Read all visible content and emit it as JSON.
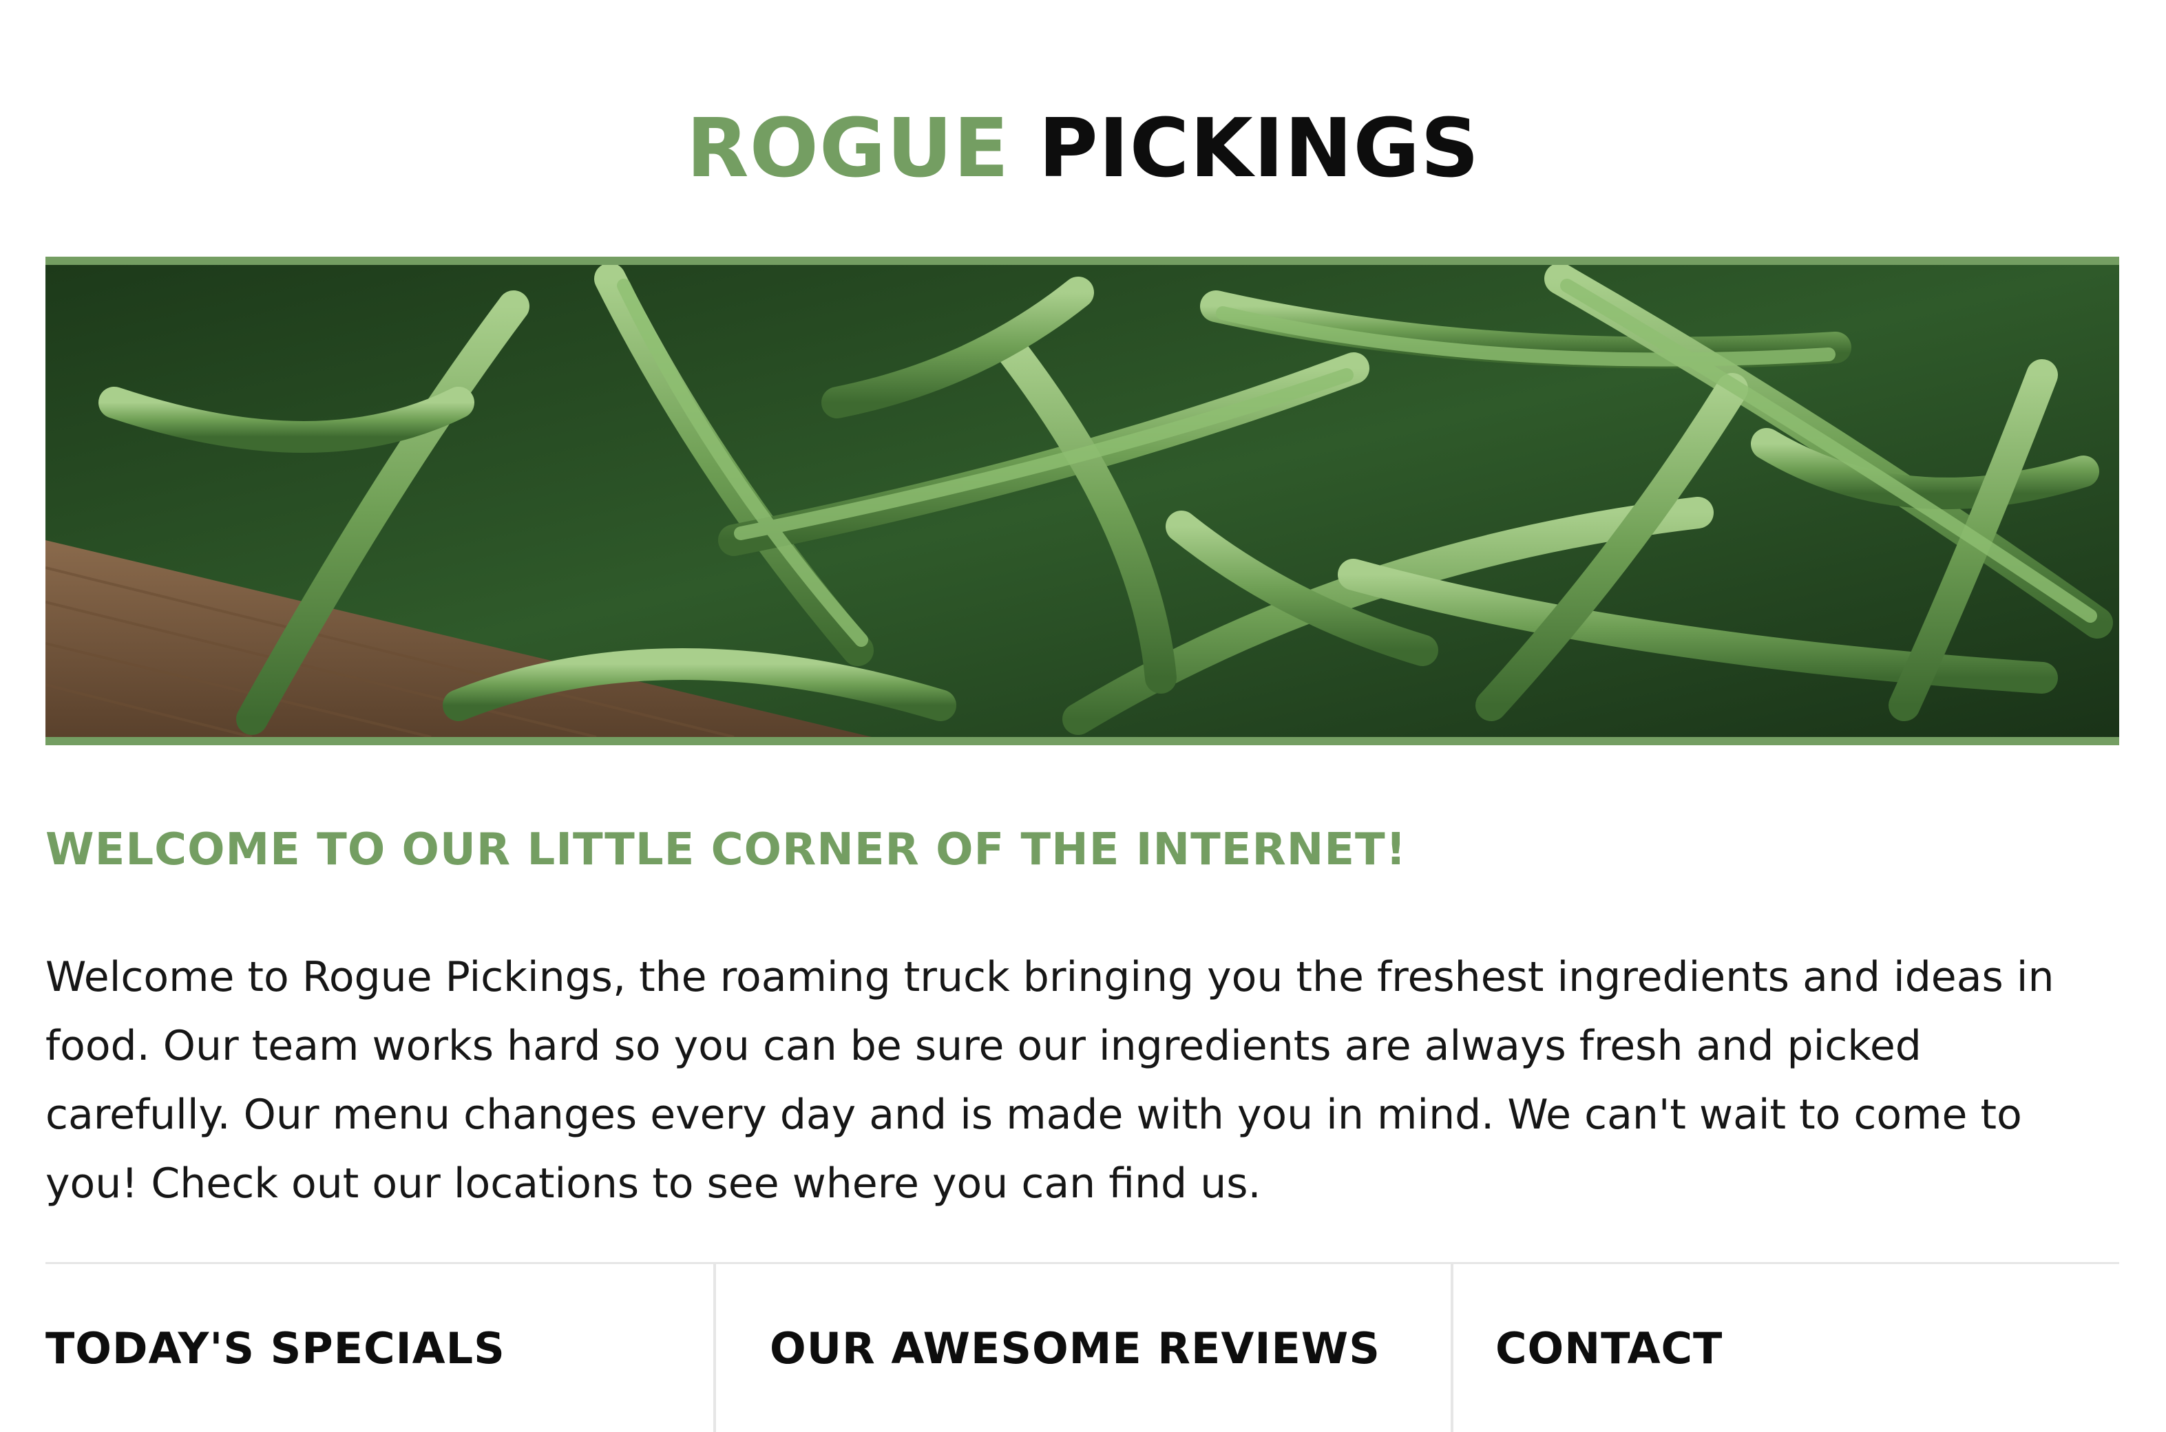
{
  "header": {
    "title_part1": "ROGUE",
    "title_part2": "PICKINGS"
  },
  "colors": {
    "accent": "#749e62",
    "text": "#0d0d0d"
  },
  "hero": {
    "image_name": "green-beans-banner"
  },
  "welcome": {
    "heading": "WELCOME TO OUR LITTLE CORNER OF THE INTERNET!",
    "body": "Welcome to Rogue Pickings, the roaming truck bringing you the freshest ingredients and ideas in food. Our team works hard so you can be sure our ingredients are always fresh and picked carefully. Our menu changes every day and is made with you in mind. We can't wait to come to you! Check out our locations to see where you can find us."
  },
  "columns": [
    {
      "heading": "TODAY'S SPECIALS"
    },
    {
      "heading": "OUR AWESOME REVIEWS"
    },
    {
      "heading": "CONTACT"
    }
  ]
}
